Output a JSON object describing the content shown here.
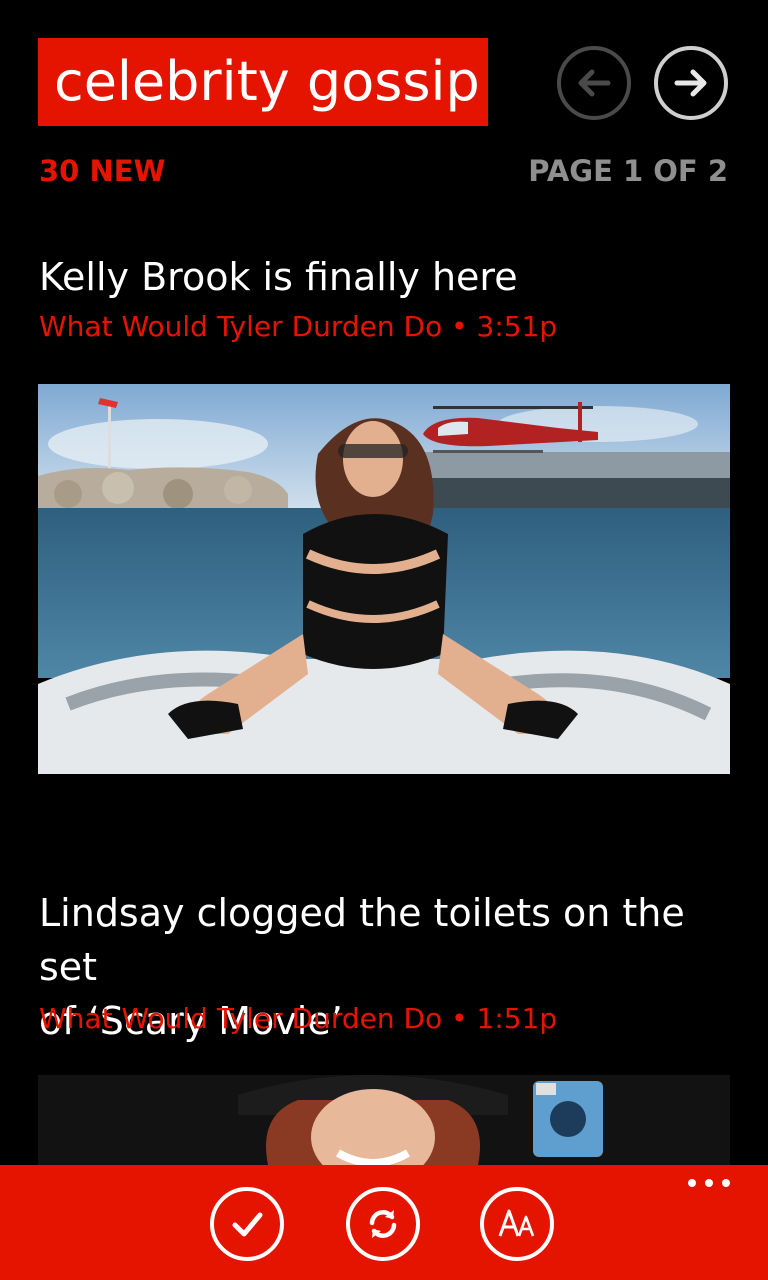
{
  "header": {
    "title": "celebrity gossip",
    "back_icon": "arrow-left-icon",
    "forward_icon": "arrow-right-icon"
  },
  "status": {
    "new_count": "30 NEW",
    "page_info": "PAGE 1 OF 2"
  },
  "articles": [
    {
      "title": "Kelly Brook is finally here",
      "meta": "What Would Tyler Durden Do • 3:51p",
      "image": "photo of woman in black swimsuit on boat with helicopter behind"
    },
    {
      "title_line1": "Lindsay clogged the toilets on the set",
      "title_line2": "of ‘Scary Movie’",
      "meta": "What Would Tyler Durden Do • 1:51p",
      "image": "photo of smiling woman in black hat"
    }
  ],
  "app_bar": {
    "buttons": [
      "check-icon",
      "refresh-icon",
      "font-size-icon"
    ],
    "more_icon": "more-dots-icon"
  },
  "colors": {
    "accent": "#e51400",
    "background": "#000000",
    "page_text": "#8f8f8f"
  }
}
